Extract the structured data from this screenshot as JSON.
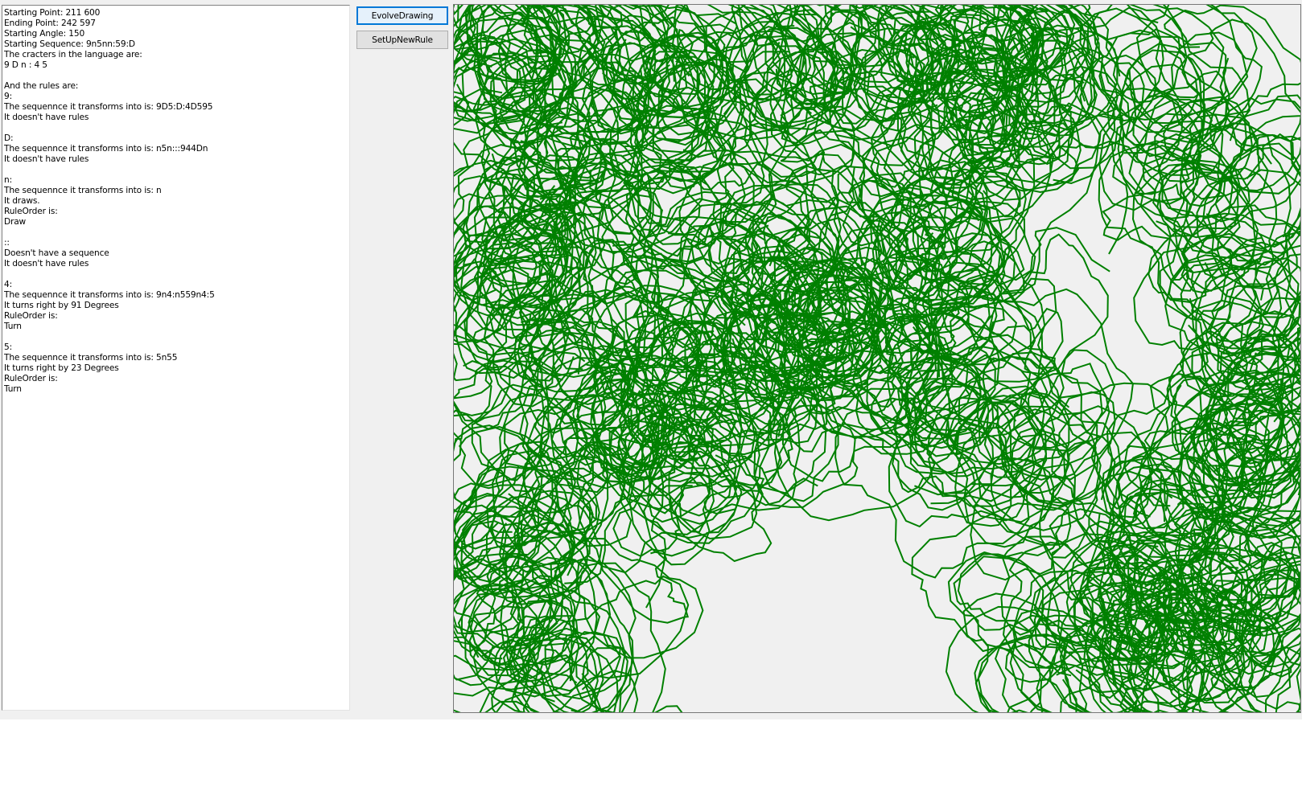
{
  "window": {
    "form_background": "#f0f0f0"
  },
  "rules_panel": {
    "lines": [
      "Starting Point: 211 600",
      "Ending Point: 242 597",
      "Starting Angle: 150",
      "Starting Sequence: 9n5nn:59:D",
      "The cracters in the language are:",
      "9 D n : 4 5",
      "",
      "And the rules are:",
      "9:",
      "The sequennce it transforms into is: 9D5:D:4D595",
      "It doesn't have rules",
      "",
      "D:",
      "The sequennce it transforms into is: n5n:::944Dn",
      "It doesn't have rules",
      "",
      "n:",
      "The sequennce it transforms into is: n",
      "It draws.",
      "RuleOrder is:",
      "Draw",
      "",
      "::",
      "Doesn't have a sequence",
      "It doesn't have rules",
      "",
      "4:",
      "The sequennce it transforms into is: 9n4:n559n4:5",
      "It turns right by 91 Degrees",
      "RuleOrder is:",
      "Turn",
      "",
      "5:",
      "The sequennce it transforms into is: 5n55",
      "It turns right by 23 Degrees",
      "RuleOrder is:",
      "Turn"
    ]
  },
  "buttons": {
    "evolve_label": "EvolveDrawing",
    "setup_label": "SetUpNewRule"
  },
  "drawing": {
    "stroke_color": "#008000",
    "background": "#f0f0f0",
    "turn_left_degrees": 91,
    "turn_right_degrees": 23
  }
}
